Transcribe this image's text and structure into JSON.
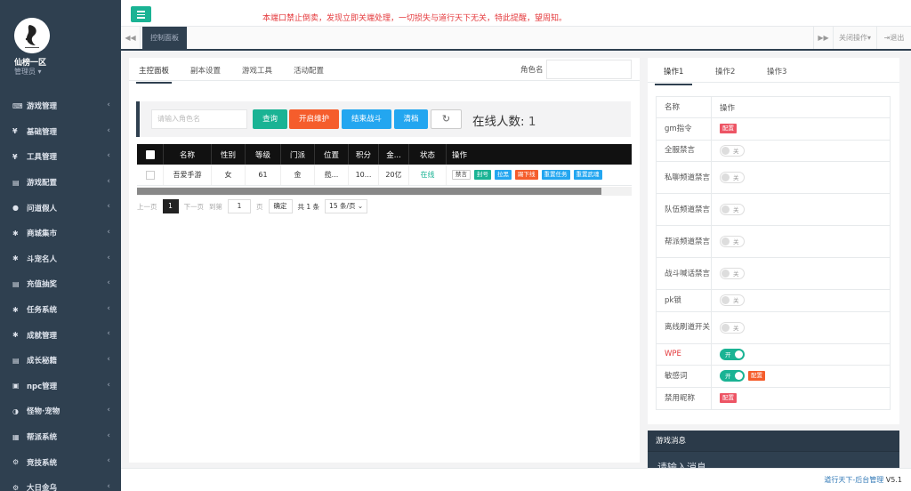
{
  "sidebar": {
    "username": "仙榜一区",
    "role": "管理员",
    "menu": [
      {
        "label": "游戏管理",
        "icon": "gamepad-icon"
      },
      {
        "label": "基础管理",
        "icon": "cutlery-icon"
      },
      {
        "label": "工具管理",
        "icon": "cutlery-icon"
      },
      {
        "label": "游戏配置",
        "icon": "list-icon"
      },
      {
        "label": "问道假人",
        "icon": "user-icon"
      },
      {
        "label": "商城集市",
        "icon": "gear-icon"
      },
      {
        "label": "斗宠名人",
        "icon": "gear-icon"
      },
      {
        "label": "充值抽奖",
        "icon": "list-icon"
      },
      {
        "label": "任务系统",
        "icon": "gear-icon"
      },
      {
        "label": "成就管理",
        "icon": "gear-icon"
      },
      {
        "label": "成长秘籍",
        "icon": "list-icon"
      },
      {
        "label": "npc管理",
        "icon": "square-icon"
      },
      {
        "label": "怪物·宠物",
        "icon": "half-circle-icon"
      },
      {
        "label": "帮派系统",
        "icon": "grid-icon"
      },
      {
        "label": "竞技系统",
        "icon": "gears-icon"
      },
      {
        "label": "大日金乌",
        "icon": "gears-icon"
      }
    ]
  },
  "topbar": {
    "notice": "本端口禁止倒卖，发现立即关端处理，一切损失与道行天下无关，特此提醒，望周知。"
  },
  "tabsbar": {
    "page_tab": "控制面板",
    "close_ops": "关闭操作",
    "logout": "退出"
  },
  "main": {
    "tabs": [
      "主控面板",
      "副本设置",
      "游戏工具",
      "活动配置"
    ],
    "role_label": "角色名",
    "search_placeholder": "请输入角色名",
    "buttons": {
      "query": "查询",
      "maintenance": "开启维护",
      "end_battle": "结束战斗",
      "clear": "清档"
    },
    "online_label": "在线人数:",
    "online_count": "1",
    "table": {
      "headers": [
        "名称",
        "性别",
        "等级",
        "门派",
        "位置",
        "积分",
        "金...",
        "状态",
        "操作"
      ],
      "rows": [
        {
          "name": "吾爱手游",
          "gender": "女",
          "level": "61",
          "sect": "金",
          "position": "揽...",
          "score": "10...",
          "gold": "20亿",
          "status": "在线",
          "actions": [
            "禁言",
            "封号",
            "拉黑",
            "踢下线",
            "重置任务",
            "重置武魂"
          ]
        }
      ]
    },
    "pager": {
      "prev": "上一页",
      "current": "1",
      "next": "下一页",
      "goto": "到第",
      "page_input": "1",
      "page_unit": "页",
      "ok": "确定",
      "total": "共 1 条",
      "per_page": "15 条/页"
    }
  },
  "right": {
    "tabs": [
      "操作1",
      "操作2",
      "操作3"
    ],
    "header_name": "名称",
    "header_op": "操作",
    "switch_off": "关",
    "switch_on": "开",
    "config": "配置",
    "rows": [
      {
        "name": "gm指令",
        "type": "config"
      },
      {
        "name": "全服禁言",
        "type": "switch"
      },
      {
        "name": "私聊频道禁言",
        "type": "switch"
      },
      {
        "name": "队伍频道禁言",
        "type": "switch"
      },
      {
        "name": "帮派频道禁言",
        "type": "switch"
      },
      {
        "name": "战斗喊话禁言",
        "type": "switch"
      },
      {
        "name": "pk锁",
        "type": "switch"
      },
      {
        "name": "离线刷道开关",
        "type": "switch"
      },
      {
        "name": "WPE",
        "type": "switch_on"
      },
      {
        "name": "敏感词",
        "type": "switch_on_config"
      },
      {
        "name": "禁用昵称",
        "type": "config"
      }
    ]
  },
  "gamemsg": {
    "title": "游戏消息",
    "placeholder": "请输入消息"
  },
  "footer": {
    "brand": "道行天下-后台管理",
    "version": "V5.1"
  },
  "colors": {
    "sidebar": "#2f4050",
    "primary": "#1ab394",
    "orange": "#f55d2c",
    "blue": "#23a6f0",
    "notice": "#e4393c"
  }
}
